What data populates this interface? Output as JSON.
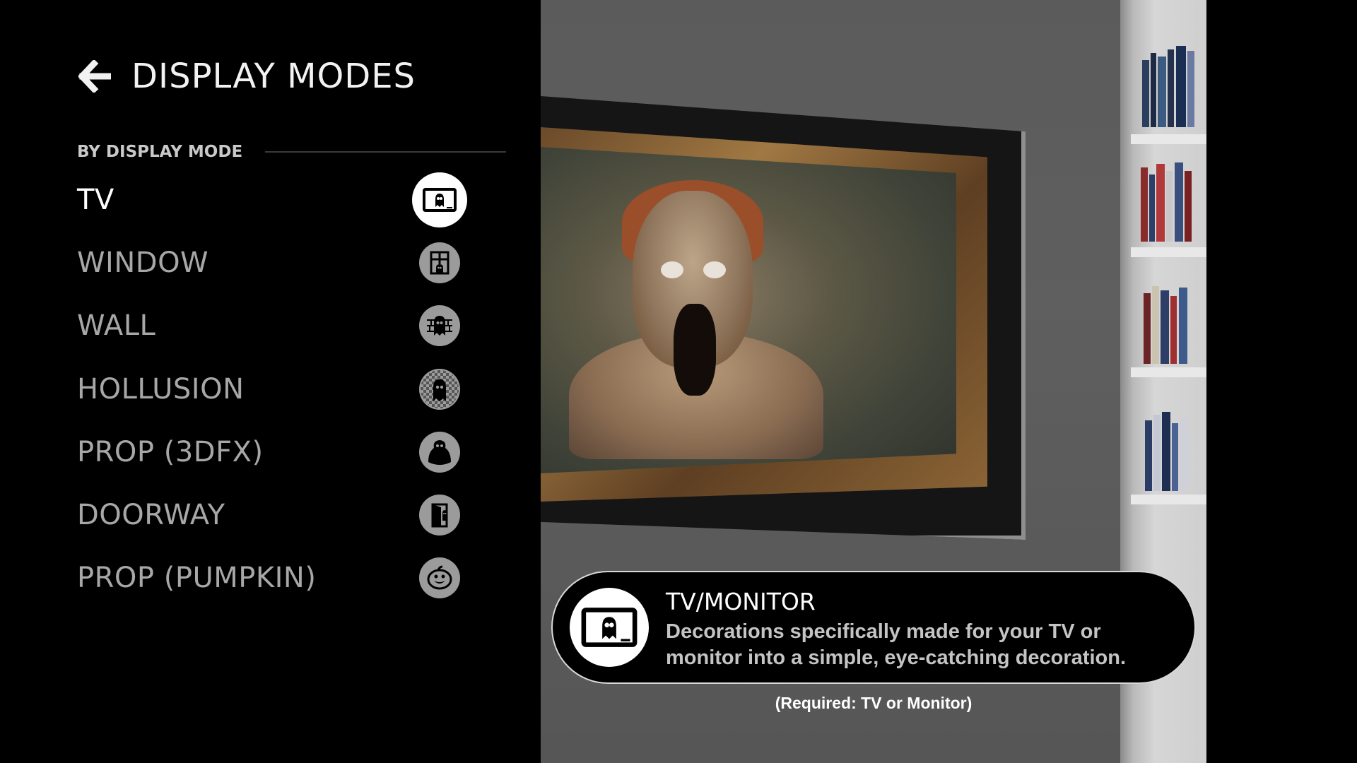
{
  "header": {
    "title": "DISPLAY MODES",
    "back_icon": "arrow-left-icon"
  },
  "section": {
    "label": "BY DISPLAY MODE"
  },
  "modes": [
    {
      "label": "TV",
      "icon": "tv-ghost-icon",
      "selected": true
    },
    {
      "label": "WINDOW",
      "icon": "window-ghost-icon",
      "selected": false
    },
    {
      "label": "WALL",
      "icon": "wall-ghost-icon",
      "selected": false
    },
    {
      "label": "HOLLUSION",
      "icon": "hollusion-ghost-icon",
      "selected": false
    },
    {
      "label": "PROP (3DFX)",
      "icon": "prop-ghost-icon",
      "selected": false
    },
    {
      "label": "DOORWAY",
      "icon": "doorway-ghost-icon",
      "selected": false
    },
    {
      "label": "PROP (PUMPKIN)",
      "icon": "pumpkin-icon",
      "selected": false
    }
  ],
  "info": {
    "title": "TV/MONITOR",
    "description": "Decorations specifically made for your TV or monitor into a simple, eye-catching decoration.",
    "requirement": "(Required: TV or Monitor)",
    "icon": "tv-ghost-icon"
  },
  "colors": {
    "background": "#000000",
    "selected_text": "#ffffff",
    "unselected_text": "#a7a7a7",
    "icon_inactive": "#9b9b9b",
    "icon_active": "#ffffff"
  }
}
